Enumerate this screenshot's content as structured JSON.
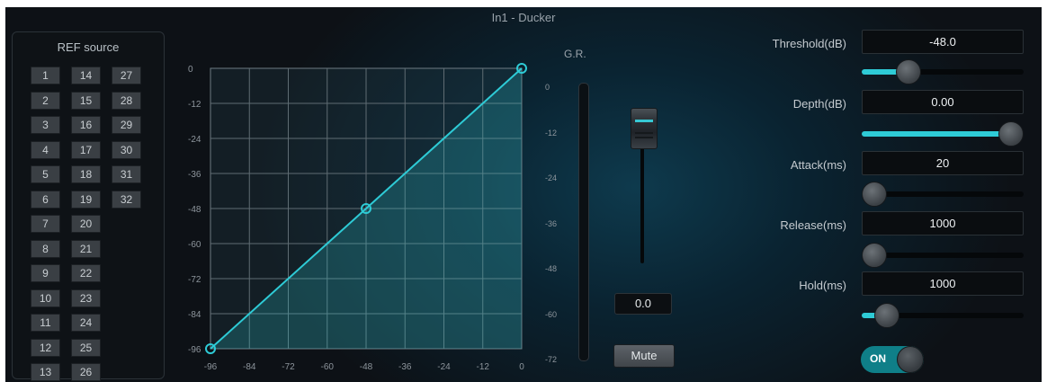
{
  "window": {
    "title": "In1 - Ducker"
  },
  "ref_source": {
    "title": "REF source",
    "columns": [
      [
        "1",
        "2",
        "3",
        "4",
        "5",
        "6",
        "7",
        "8",
        "9",
        "10",
        "11",
        "12",
        "13"
      ],
      [
        "14",
        "15",
        "16",
        "17",
        "18",
        "19",
        "20",
        "21",
        "22",
        "23",
        "24",
        "25",
        "26"
      ],
      [
        "27",
        "28",
        "29",
        "30",
        "31",
        "32"
      ]
    ]
  },
  "graph": {
    "y_ticks": [
      "0",
      "-12",
      "-24",
      "-36",
      "-48",
      "-60",
      "-72",
      "-84",
      "-96"
    ],
    "x_ticks": [
      "-96",
      "-84",
      "-72",
      "-60",
      "-48",
      "-36",
      "-24",
      "-12",
      "0"
    ],
    "threshold_point": -48
  },
  "gain_reduction": {
    "label": "G.R.",
    "ticks": [
      "0",
      "-12",
      "-24",
      "-36",
      "-48",
      "-60",
      "-72"
    ],
    "level": 0
  },
  "fader": {
    "value": "0.0",
    "level": 0.95
  },
  "mute": {
    "label": "Mute"
  },
  "params": {
    "threshold": {
      "label": "Threshold(dB)",
      "value": "-48.0",
      "level": 0.25
    },
    "depth": {
      "label": "Depth(dB)",
      "value": "0.00",
      "level": 1.0
    },
    "attack": {
      "label": "Attack(ms)",
      "value": "20",
      "level": 0.0
    },
    "release": {
      "label": "Release(ms)",
      "value": "1000",
      "level": 0.0
    },
    "hold": {
      "label": "Hold(ms)",
      "value": "1000",
      "level": 0.09
    }
  },
  "toggle": {
    "label": "ON",
    "state": true
  },
  "colors": {
    "accent": "#2ecbd6",
    "panel": "#0d1116",
    "button": "#3a3f44"
  }
}
